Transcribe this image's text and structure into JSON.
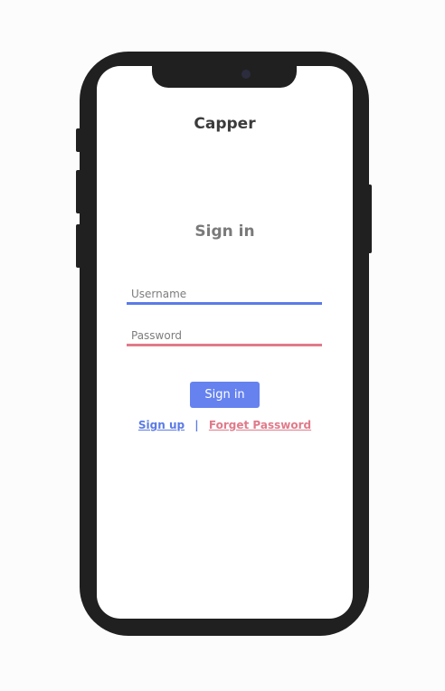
{
  "app": {
    "title": "Capper"
  },
  "login": {
    "heading": "Sign in",
    "username": {
      "placeholder": "Username",
      "value": ""
    },
    "password": {
      "placeholder": "Password",
      "value": ""
    },
    "submit_label": "Sign in",
    "signup_label": "Sign up",
    "separator": "|",
    "forgot_label": "Forget Password"
  },
  "colors": {
    "primary": "#5b7be6",
    "button": "#6582ef",
    "accent_pink": "#e07a8a",
    "frame": "#202020"
  }
}
